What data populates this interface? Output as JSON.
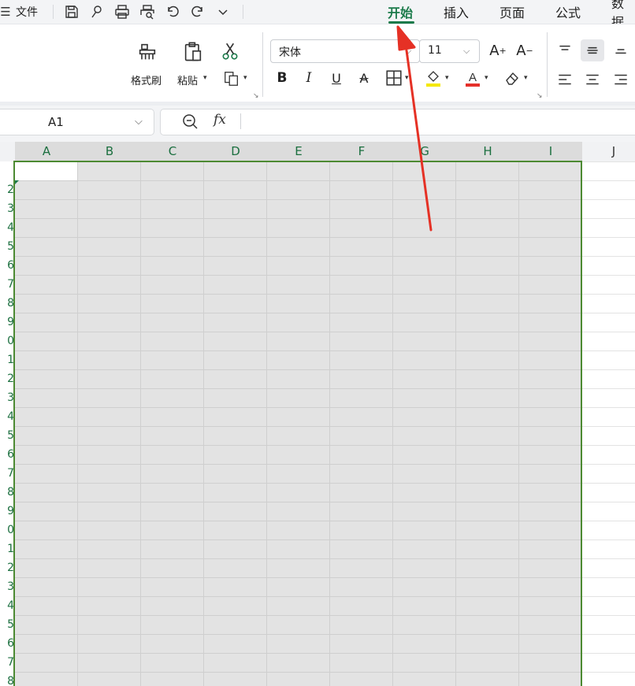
{
  "menubar": {
    "menu_icon": "☰",
    "file": "文件",
    "tabs": [
      "开始",
      "插入",
      "页面",
      "公式",
      "数据"
    ],
    "active_tab": "开始",
    "icons": [
      "save-icon",
      "format-brush-small-icon",
      "print-icon",
      "print-preview-icon",
      "undo-icon",
      "redo-icon",
      "more-chevron-icon"
    ]
  },
  "ribbon": {
    "format_painter": "格式刷",
    "paste": "粘贴",
    "paste_caret": "⌄",
    "font_name": "宋体",
    "font_size": "11",
    "buttons": {
      "bold": "B",
      "italic": "I",
      "underline": "U",
      "strike": "A",
      "increase_font": "A",
      "decrease_font": "A"
    },
    "colors": {
      "highlight": "#f5e800",
      "font_color": "#e5302a",
      "accent": "#1b7a4a"
    }
  },
  "formula_bar": {
    "name_box": "A1",
    "fx": "fx"
  },
  "sheet": {
    "columns": [
      "A",
      "B",
      "C",
      "D",
      "E",
      "F",
      "G",
      "H",
      "I",
      "J"
    ],
    "row_labels": [
      "",
      "2",
      "3",
      "4",
      "5",
      "6",
      "7",
      "8",
      "9",
      "0",
      "1",
      "2",
      "3",
      "4",
      "5",
      "6",
      "7",
      "8",
      "9",
      "0",
      "1",
      "2",
      "3",
      "4",
      "5",
      "6",
      "7",
      "8"
    ],
    "selection_color": "#4c8a32"
  },
  "annotation": {
    "arrow_color": "#e53125"
  }
}
